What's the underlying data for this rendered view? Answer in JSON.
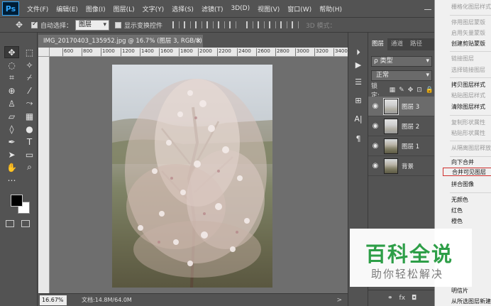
{
  "menubar": {
    "logo": "Ps",
    "items": [
      "文件(F)",
      "编辑(E)",
      "图像(I)",
      "图层(L)",
      "文字(Y)",
      "选择(S)",
      "滤镜(T)",
      "3D(D)",
      "视图(V)",
      "窗口(W)",
      "帮助(H)"
    ]
  },
  "options": {
    "auto_select_label": "自动选择：",
    "auto_select_target": "图层",
    "show_transform_label": "显示变换控件",
    "mode3d_label": "3D 模式："
  },
  "document": {
    "tab_title": "IMG_20170403_135952.jpg @ 16.7% (图层 3, RGB/8) *",
    "close_glyph": "×",
    "ruler_ticks": [
      "600",
      "800",
      "1000",
      "1200",
      "1400",
      "1600",
      "1800",
      "2000",
      "2200",
      "2400",
      "2600",
      "2800",
      "3000",
      "3200",
      "3400"
    ]
  },
  "status": {
    "zoom": "16.67%",
    "doc_size": "文档:14.8M/64.0M",
    "arrow": ">"
  },
  "layers_panel": {
    "tabs": [
      "图层",
      "通道",
      "路径"
    ],
    "filter_label": "ρ 类型",
    "blend_mode": "正常",
    "lock_label": "锁定:",
    "layers": [
      {
        "name": "图层 3",
        "selected": true
      },
      {
        "name": "图层 2",
        "selected": false
      },
      {
        "name": "图层 1",
        "selected": false
      },
      {
        "name": "背景",
        "selected": false
      }
    ],
    "bottom_icons": [
      "link-icon",
      "fx-icon",
      "mask-icon"
    ],
    "fx_label": "fx"
  },
  "context_menu": {
    "items": [
      {
        "label": "栅格化图层样式",
        "enabled": false
      },
      {
        "label": "停用图层蒙版",
        "enabled": false
      },
      {
        "label": "启用矢量蒙版",
        "enabled": false
      },
      {
        "label": "创建剪贴蒙版",
        "enabled": true
      },
      {
        "label": "链接图层",
        "enabled": false
      },
      {
        "label": "选择链接图层",
        "enabled": false
      },
      {
        "label": "拷贝图层样式",
        "enabled": true
      },
      {
        "label": "粘贴图层样式",
        "enabled": false
      },
      {
        "label": "清除图层样式",
        "enabled": true
      },
      {
        "label": "复制形状属性",
        "enabled": false
      },
      {
        "label": "粘贴形状属性",
        "enabled": false
      },
      {
        "label": "从隔离图层释放",
        "enabled": false
      },
      {
        "label": "向下合并",
        "enabled": true
      },
      {
        "label": "合并可见图层",
        "enabled": true,
        "highlight": true
      },
      {
        "label": "拼合图像",
        "enabled": true
      },
      {
        "label": "无颜色",
        "enabled": true
      },
      {
        "label": "红色",
        "enabled": true
      },
      {
        "label": "橙色",
        "enabled": true
      },
      {
        "label": "明信片",
        "enabled": true
      },
      {
        "label": "从所选图层新建",
        "enabled": true
      }
    ]
  },
  "watermark": {
    "title": "百科全说",
    "subtitle": "助你轻松解决"
  },
  "colors": {
    "accent_green": "#2d9e47",
    "highlight_border": "#d0302e",
    "ui_bg": "#535353"
  }
}
